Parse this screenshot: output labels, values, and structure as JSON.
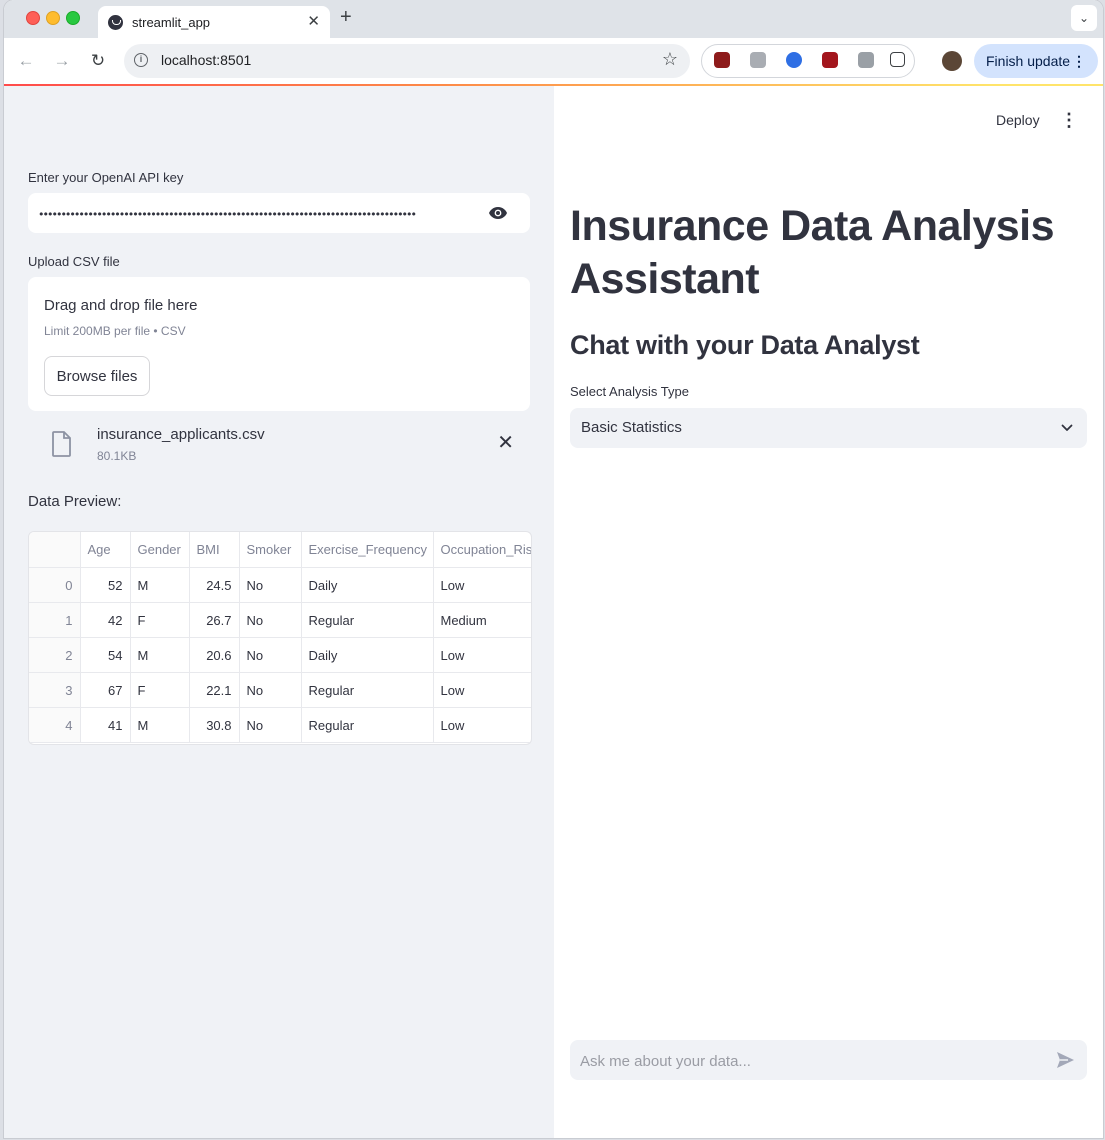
{
  "browser": {
    "tab_title": "streamlit_app",
    "tab_close": "✕",
    "new_tab": "+",
    "url": "localhost:8501",
    "finish_update": "Finish update"
  },
  "sidebar": {
    "api_key_label": "Enter your OpenAI API key",
    "api_key_value": "••••••••••••••••••••••••••••••••••••••••••••••••••••••••••••••••••••••••••••••••••••",
    "upload_label": "Upload CSV file",
    "dropzone_title": "Drag and drop file here",
    "dropzone_limit": "Limit 200MB per file • CSV",
    "browse_button": "Browse files",
    "uploaded_file": {
      "name": "insurance_applicants.csv",
      "size": "80.1KB"
    },
    "preview_label": "Data Preview:",
    "table": {
      "columns": [
        "",
        "Age",
        "Gender",
        "BMI",
        "Smoker",
        "Exercise_Frequency",
        "Occupation_Risk"
      ],
      "rows": [
        [
          "0",
          "52",
          "M",
          "24.5",
          "No",
          "Daily",
          "Low"
        ],
        [
          "1",
          "42",
          "F",
          "26.7",
          "No",
          "Regular",
          "Medium"
        ],
        [
          "2",
          "54",
          "M",
          "20.6",
          "No",
          "Daily",
          "Low"
        ],
        [
          "3",
          "67",
          "F",
          "22.1",
          "No",
          "Regular",
          "Low"
        ],
        [
          "4",
          "41",
          "M",
          "30.8",
          "No",
          "Regular",
          "Low"
        ]
      ]
    }
  },
  "main": {
    "deploy": "Deploy",
    "title": "Insurance Data Analysis Assistant",
    "subheader": "Chat with your Data Analyst",
    "select_label": "Select Analysis Type",
    "select_value": "Basic Statistics",
    "chat_placeholder": "Ask me about your data..."
  },
  "colors": {
    "primary": "#ff4b4b",
    "sidebar_bg": "#f0f2f6",
    "text": "#31333f"
  }
}
